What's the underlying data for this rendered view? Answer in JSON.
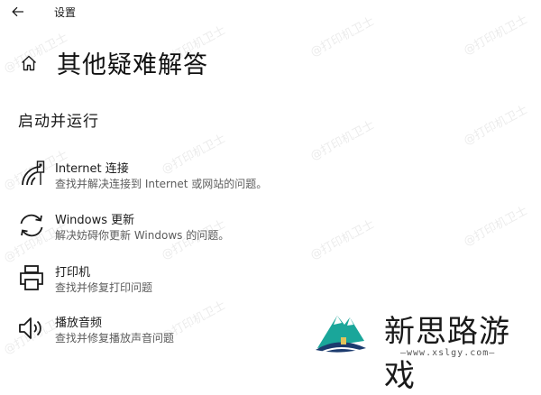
{
  "app_title": "设置",
  "page_title": "其他疑难解答",
  "section_title": "启动并运行",
  "items": [
    {
      "name": "Internet 连接",
      "desc": "查找并解决连接到 Internet 或网站的问题。",
      "icon": "wifi-icon"
    },
    {
      "name": "Windows 更新",
      "desc": "解决妨碍你更新 Windows 的问题。",
      "icon": "update-icon"
    },
    {
      "name": "打印机",
      "desc": "查找并修复打印问题",
      "icon": "printer-icon"
    },
    {
      "name": "播放音频",
      "desc": "查找并修复播放声音问题",
      "icon": "speaker-icon"
    }
  ],
  "watermark_text": "@打印机卫士",
  "brand": {
    "name": "新思路游戏",
    "url": "—www.xslgy.com—"
  },
  "colors": {
    "background": "#ffffff",
    "text": "#1a1a1a",
    "secondary_text": "#5c5c5c",
    "logo_teal": "#1aa69a",
    "logo_navy": "#1c3b6e"
  }
}
